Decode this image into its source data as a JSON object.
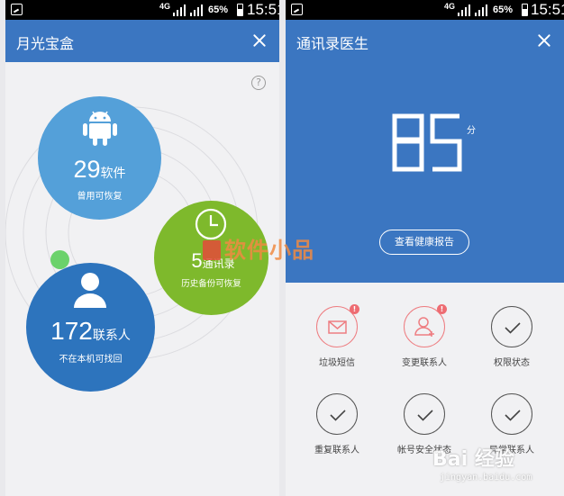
{
  "status_bar": {
    "network": "4G",
    "battery": "65%",
    "time": "15:51"
  },
  "left": {
    "title": "月光宝盒",
    "help_symbol": "?",
    "bubbles": {
      "apps": {
        "number": "29",
        "unit": "软件",
        "caption": "曾用可恢复",
        "icon": "android-icon"
      },
      "backup": {
        "number": "5",
        "unit": "通讯录",
        "caption": "历史备份可恢复",
        "icon": "clock-icon"
      },
      "contacts": {
        "number": "172",
        "unit": "联系人",
        "caption": "不在本机可找回",
        "icon": "person-icon"
      }
    }
  },
  "right": {
    "title": "通讯录医生",
    "score": "85",
    "score_unit": "分",
    "report_button": "查看健康报告",
    "checks": [
      {
        "label": "垃圾短信",
        "icon": "mail-icon",
        "alert": "!"
      },
      {
        "label": "变更联系人",
        "icon": "person-add-icon",
        "alert": "!"
      },
      {
        "label": "权限状态",
        "icon": "check-icon"
      },
      {
        "label": "重复联系人",
        "icon": "check-icon"
      },
      {
        "label": "帐号安全状态",
        "icon": "check-icon"
      },
      {
        "label": "异常联系人",
        "icon": "check-icon"
      }
    ]
  },
  "watermarks": {
    "software": "软件小品",
    "baidu": "Bai 经验",
    "baidu_url": "jingyan.baidu.com"
  },
  "colors": {
    "header_blue": "#3b76c1",
    "apps_blue": "#54a0d9",
    "backup_green": "#7eb92c",
    "contacts_blue": "#2d74bd",
    "alert_red": "#ee6c72"
  }
}
